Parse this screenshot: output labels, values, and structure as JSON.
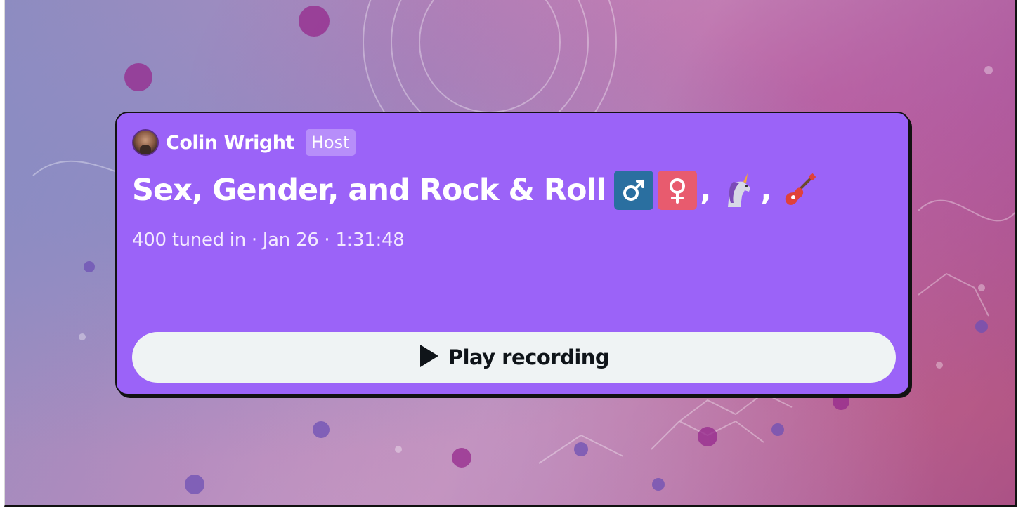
{
  "space": {
    "host": {
      "name": "Colin Wright",
      "role_badge": "Host"
    },
    "title": {
      "text": "Sex, Gender, and Rock & Roll",
      "emojis": [
        "male-sign-icon",
        "female-sign-icon",
        "unicorn-icon",
        "guitar-icon"
      ],
      "separator": ","
    },
    "meta": "400 tuned in · Jan 26 · 1:31:48",
    "play_button_label": "Play recording"
  },
  "colors": {
    "card_background": "#9b63f8",
    "button_background": "#eff3f4",
    "male_sign_box": "#2a6fa0",
    "female_sign_box": "#e85b6e",
    "text_primary": "#ffffff",
    "button_text": "#0f1419"
  }
}
